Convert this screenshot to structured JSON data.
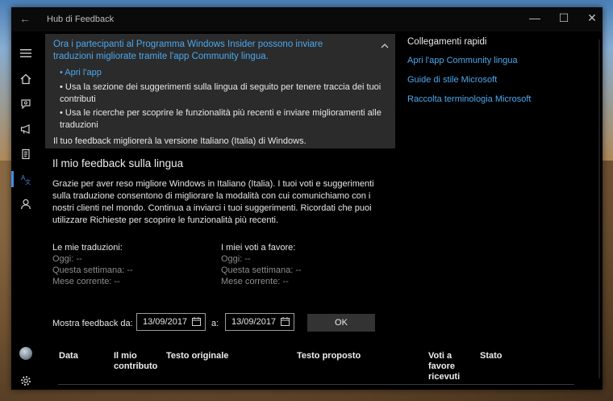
{
  "window": {
    "title": "Hub di Feedback",
    "back_icon": "back-arrow-icon",
    "controls": [
      "minimize-icon",
      "maximize-icon",
      "close-icon"
    ]
  },
  "sidebar": {
    "items": [
      {
        "name": "menu",
        "icon": "hamburger-icon"
      },
      {
        "name": "home",
        "icon": "home-icon"
      },
      {
        "name": "feedback",
        "icon": "feedback-icon"
      },
      {
        "name": "announcements",
        "icon": "megaphone-icon"
      },
      {
        "name": "quests",
        "icon": "quest-icon"
      },
      {
        "name": "language",
        "icon": "language-icon",
        "active": true
      },
      {
        "name": "profile",
        "icon": "person-icon"
      }
    ],
    "bottom": [
      {
        "name": "account",
        "icon": "avatar-icon"
      },
      {
        "name": "settings",
        "icon": "gear-icon"
      }
    ]
  },
  "banner": {
    "heading": "Ora i partecipanti al Programma Windows Insider possono inviare traduzioni migliorate tramite l'app Community lingua.",
    "link": "• Apri l'app",
    "bullet1": "• Usa la sezione dei suggerimenti sulla lingua di seguito per tenere traccia dei tuoi contributi",
    "bullet2": "• Usa le ricerche per scoprire le funzionalità più recenti e inviare miglioramenti alle traduzioni",
    "note": "Il tuo feedback migliorerà la versione Italiano (Italia) di Windows."
  },
  "quick_links": {
    "heading": "Collegamenti rapidi",
    "links": [
      "Apri l'app Community lingua",
      "Guide di stile Microsoft",
      "Raccolta terminologia Microsoft"
    ]
  },
  "main": {
    "title": "Il mio feedback sulla lingua",
    "description": "Grazie per aver reso migliore Windows in Italiano (Italia). I tuoi voti e suggerimenti sulla traduzione consentono di migliorare la modalità con cui comunichiamo con i nostri clienti nel mondo. Continua a inviarci i tuoi suggerimenti. Ricordati che puoi utilizzare Richieste per scoprire le funzionalità più recenti."
  },
  "stats": {
    "translations": {
      "heading": "Le mie traduzioni:",
      "today": "Oggi: --",
      "week": "Questa settimana: --",
      "month": "Mese corrente: --"
    },
    "votes": {
      "heading": "I miei voti a favore:",
      "today": "Oggi: --",
      "week": "Questa settimana: --",
      "month": "Mese corrente: --"
    }
  },
  "filter": {
    "label": "Mostra feedback da:",
    "from": "13/09/2017",
    "separator": "a:",
    "to": "13/09/2017",
    "ok": "OK"
  },
  "table": {
    "headers": [
      "Data",
      "Il mio contributo",
      "Testo originale",
      "Testo proposto",
      "Voti a favore ricevuti",
      "Stato"
    ]
  }
}
